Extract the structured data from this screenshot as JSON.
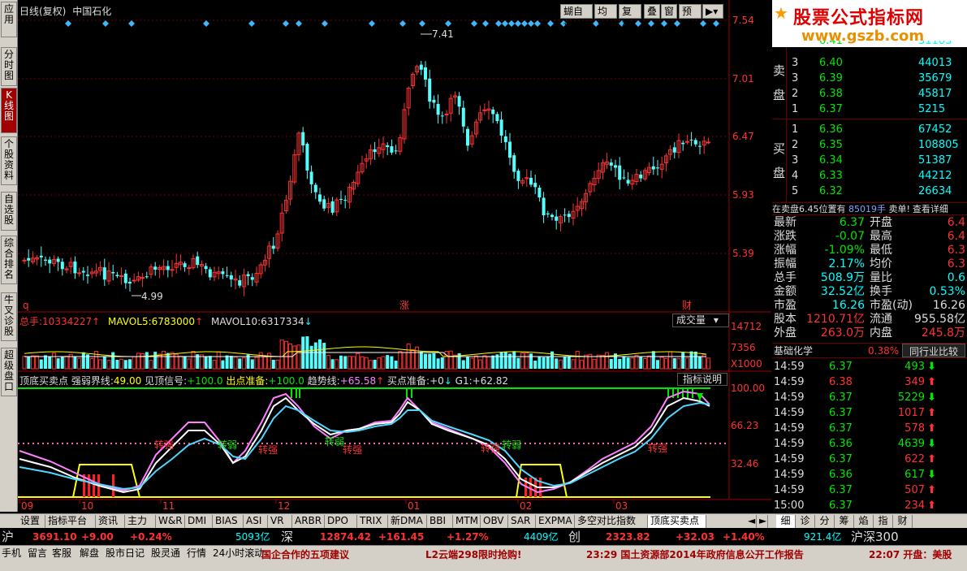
{
  "left_tabs": [
    "应用",
    "分时图",
    "K线图",
    "个股资料",
    "自选股",
    "综合排名",
    "牛叉诊股",
    "超级盘口"
  ],
  "header": {
    "period": "日线(复权)",
    "stock": "中国石化",
    "buttons": [
      "蝴自选",
      "均线",
      "复权",
      "叠",
      "窗",
      "预测"
    ]
  },
  "price_axis": [
    "7.54",
    "7.01",
    "6.47",
    "5.93",
    "5.39"
  ],
  "annotations": {
    "high": "7.41",
    "low": "4.99",
    "markers": [
      "q",
      "涨",
      "财"
    ]
  },
  "volume": {
    "legend_label": "总手:",
    "total": "10334227",
    "ma5_label": "MAVOL5:",
    "ma5": "6783000",
    "ma10_label": "MAVOL10:",
    "ma10": "6317334",
    "selector": "成交量",
    "axis": [
      "14712",
      "7356",
      "X1000"
    ]
  },
  "indicator": {
    "name": "顶底买卖点",
    "weak_label": "强弱界线:",
    "weak": "49.00",
    "top_label": "见顶信号:",
    "top": "+100.0",
    "exit_label": "出点准备:",
    "exit": "+100.0",
    "trend_label": "趋势线:",
    "trend": "+65.58",
    "buy_label": "买点准备:",
    "buy": "+0",
    "g1_label": "G1:",
    "g1": "+62.82",
    "explain": "指标说明",
    "axis": [
      "100.00",
      "66.23",
      "32.46"
    ],
    "labels": [
      "转强",
      "转弱"
    ]
  },
  "date_axis": [
    "09",
    "10",
    "11",
    "12",
    "01",
    "02",
    "03"
  ],
  "logo": {
    "title": "股票公式指标网",
    "url": "www.gszb.com"
  },
  "order_book": {
    "sell_label": "卖盘",
    "buy_label": "买盘",
    "sell": [
      {
        "n": "3",
        "p": "6.40",
        "v": "44013"
      },
      {
        "n": "3",
        "p": "6.39",
        "v": "35679"
      },
      {
        "n": "2",
        "p": "6.38",
        "v": "45817"
      },
      {
        "n": "1",
        "p": "6.37",
        "v": "5215"
      }
    ],
    "buy": [
      {
        "n": "1",
        "p": "6.36",
        "v": "67452"
      },
      {
        "n": "2",
        "p": "6.35",
        "v": "108805"
      },
      {
        "n": "3",
        "p": "6.34",
        "v": "51387"
      },
      {
        "n": "4",
        "p": "6.33",
        "v": "44212"
      },
      {
        "n": "5",
        "p": "6.32",
        "v": "26634"
      }
    ],
    "top_partial": {
      "p": "6.41",
      "v": "31103"
    }
  },
  "sell_notice": {
    "text": "在卖盘6.45位置有",
    "qty": "85019手",
    "tag": "卖单!",
    "link": "查看详细"
  },
  "stats": [
    {
      "l1": "最新",
      "v1": "6.37",
      "l2": "开盘",
      "v2": "6.4"
    },
    {
      "l1": "涨跌",
      "v1": "-0.07",
      "l2": "最高",
      "v2": "6.4"
    },
    {
      "l1": "涨幅",
      "v1": "-1.09%",
      "l2": "最低",
      "v2": "6.3"
    },
    {
      "l1": "振幅",
      "v1": "2.17%",
      "l2": "均价",
      "v2": "6.3"
    },
    {
      "l1": "总手",
      "v1": "508.9万",
      "l2": "量比",
      "v2": "0.6"
    },
    {
      "l1": "金额",
      "v1": "32.52亿",
      "l2": "换手",
      "v2": "0.53%"
    },
    {
      "l1": "市盈",
      "v1": "16.26",
      "l2": "市盈(动)",
      "v2": "16.26"
    },
    {
      "l1": "股本",
      "v1": "1210.71亿",
      "l2": "流通",
      "v2": "955.58亿"
    },
    {
      "l1": "外盘",
      "v1": "263.0万",
      "l2": "内盘",
      "v2": "245.8万"
    }
  ],
  "industry": {
    "name": "基础化学",
    "change": "0.38%",
    "compare": "同行业比较"
  },
  "ticks": [
    {
      "t": "14:59",
      "p": "6.37",
      "v": "493",
      "d": "down"
    },
    {
      "t": "14:59",
      "p": "6.38",
      "v": "349",
      "d": "up"
    },
    {
      "t": "14:59",
      "p": "6.37",
      "v": "5229",
      "d": "down"
    },
    {
      "t": "14:59",
      "p": "6.37",
      "v": "1017",
      "d": "up"
    },
    {
      "t": "14:59",
      "p": "6.37",
      "v": "578",
      "d": "up"
    },
    {
      "t": "14:59",
      "p": "6.36",
      "v": "4639",
      "d": "down"
    },
    {
      "t": "14:59",
      "p": "6.37",
      "v": "622",
      "d": "up"
    },
    {
      "t": "14:59",
      "p": "6.36",
      "v": "617",
      "d": "down"
    },
    {
      "t": "14:59",
      "p": "6.37",
      "v": "507",
      "d": "up"
    },
    {
      "t": "15:00",
      "p": "6.37",
      "v": "234",
      "d": "up"
    }
  ],
  "bottom_tabs": [
    "设置",
    "指标平台",
    "资讯",
    "主力",
    "W&R",
    "DMI",
    "BIAS",
    "ASI",
    "VR",
    "ARBR",
    "DPO",
    "TRIX",
    "新DMA",
    "BBI",
    "MTM",
    "OBV",
    "SAR",
    "EXPMA",
    "多空对比指数",
    "顶底买卖点"
  ],
  "right_tabs": [
    "细",
    "诊",
    "分",
    "筹",
    "焰",
    "指",
    "财"
  ],
  "index_bar": [
    {
      "name": "沪",
      "value": "3691.10",
      "chg": "+9.00",
      "pct": "+0.24%",
      "amount": "5093亿"
    },
    {
      "name": "深",
      "value": "12874.42",
      "chg": "+161.45",
      "pct": "+1.27%",
      "amount": "4409亿"
    },
    {
      "name": "创",
      "value": "2323.82",
      "chg": "+32.03",
      "pct": "+1.40%",
      "amount": "921.4亿"
    },
    {
      "name": "沪深300",
      "value": "",
      "chg": "",
      "pct": "",
      "amount": ""
    }
  ],
  "status_bar": {
    "buttons": [
      "手机",
      "留言",
      "客服",
      "解盘",
      "股市日记",
      "股灵通",
      "行情",
      "24小时滚动"
    ],
    "news1": "国企合作的五项建议",
    "news2": "L2云端298限时抢购!",
    "news3": "23:29 国土资源部2014年政府信息公开工作报告",
    "news4": "22:07 开盘：美股"
  },
  "colors": {
    "up": "#ff3232",
    "down": "#54ffff",
    "white_line": "#ffffff",
    "pink_line": "#ff80ff",
    "cyan_line": "#4fd7ff",
    "yellow": "#ffff00",
    "green": "#00e600"
  }
}
